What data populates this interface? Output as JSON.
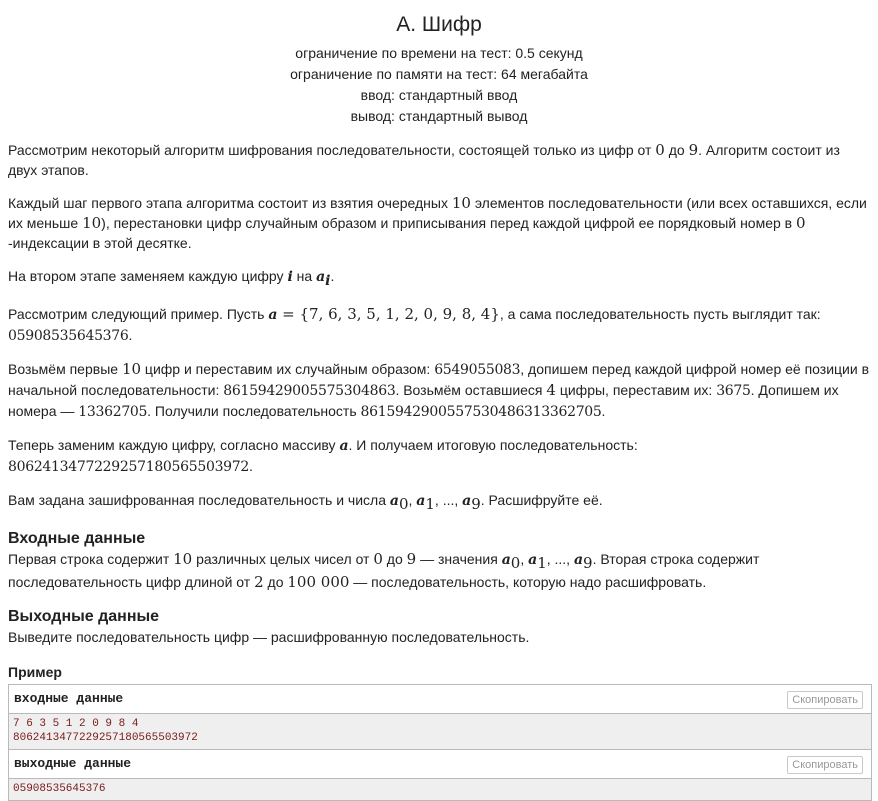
{
  "header": {
    "title": "A. Шифр",
    "time_limit": "ограничение по времени на тест: 0.5 секунд",
    "memory_limit": "ограничение по памяти на тест: 64 мегабайта",
    "input": "ввод: стандартный ввод",
    "output": "вывод: стандартный вывод"
  },
  "statement": {
    "p1": {
      "t1": "Рассмотрим некоторый алгоритм шифрования последовательности, состоящей только из цифр от ",
      "m1": "0",
      "t2": " до ",
      "m2": "9",
      "t3": ". Алгоритм состоит из двух этапов."
    },
    "p2": {
      "t1": "Каждый шаг первого этапа алгоритма состоит из взятия очередных ",
      "m1": "10",
      "t2": " элементов последовательности (или всех оставшихся, если их меньше ",
      "m2": "10",
      "t3": "), перестановки цифр случайным образом и приписывания перед каждой цифрой ее порядковый номер в ",
      "m3": "0",
      "t4": "-индексации в этой десятке."
    },
    "p3": {
      "t1": "На втором этапе заменяем каждую цифру ",
      "m1": "i",
      "t2": " на ",
      "m2": "a",
      "m2sub": "i",
      "t3": "."
    },
    "p4": {
      "t1": "Рассмотрим следующий пример. Пусть ",
      "m1": "a",
      "m1eq": " = {7, 6, 3, 5, 1, 2, 0, 9, 8, 4}",
      "t2": ", а сама последовательность пусть выглядит так: ",
      "m2": "05908535645376",
      "t3": "."
    },
    "p5": {
      "t1": "Возьмём первые ",
      "m1": "10",
      "t2": " цифр и переставим их случайным образом: ",
      "m2": "6549055083",
      "t3": ", допишем перед каждой цифрой номер её позиции в начальной последовательности: ",
      "m3": "86159429005575304863",
      "t4": ". Возьмём оставшиеся ",
      "m4": "4",
      "t5": " цифры, переставим их: ",
      "m5": "3675",
      "t6": ". Допишем их номера — ",
      "m6": "13362705",
      "t7": ". Получили последовательность ",
      "m7": "8615942900557530486313362705",
      "t8": "."
    },
    "p6": {
      "t1": "Теперь заменим каждую цифру, согласно массиву ",
      "m1": "a",
      "t2": ". И получаем итоговую последовательность: ",
      "m2": "806241347722925718056550397­2",
      "t3": "."
    },
    "p7": {
      "t1": "Вам задана зашифрованная последовательность и числа ",
      "a": "a",
      "s0": "0",
      "s1": "1",
      "s9": "9",
      "comma": ", ",
      "dots": ", ..., ",
      "t2": ". Расшифруйте её."
    }
  },
  "input_section": {
    "title": "Входные данные",
    "t1": "Первая строка содержит ",
    "m1": "10",
    "t2": " различных целых чисел от ",
    "m2": "0",
    "t3": " до ",
    "m3": "9",
    "t4": " — значения ",
    "t5": ". Вторая строка содержит последовательность цифр длиной от ",
    "m4": "2",
    "t6": " до ",
    "m5": "100 000",
    "t7": " — последовательность, которую надо расшифровать."
  },
  "output_section": {
    "title": "Выходные данные",
    "text": "Выведите последовательность цифр — расшифрованную последовательность."
  },
  "example": {
    "title": "Пример",
    "input_label": "входные данные",
    "output_label": "выходные данные",
    "copy_label": "Скопировать",
    "input_lines": [
      "7 6 3 5 1 2 0 9 8 4",
      "8062413477229257180565503972"
    ],
    "output_lines": [
      "05908535645376"
    ]
  }
}
